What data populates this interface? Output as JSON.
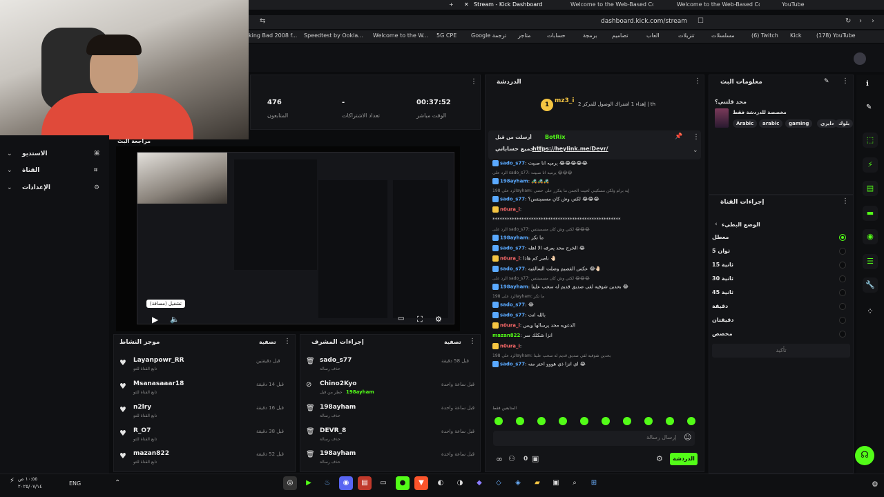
{
  "browser": {
    "tabs": [
      {
        "label": "Stream - Kick Dashboard",
        "active": true
      },
      {
        "label": "Welcome to the Web-Based Config"
      },
      {
        "label": "Welcome to the Web-Based Config"
      },
      {
        "label": "YouTube"
      }
    ],
    "url": "dashboard.kick.com/stream",
    "bookmarks": [
      "king Bad 2008 f...",
      "Speedtest by Ookla...",
      "Welcome to the W...",
      "5G CPE",
      "Google ترجمة",
      "متاجر",
      "حسابات",
      "برمجة",
      "تصاميم",
      "العاب",
      "تنزيلات",
      "مسلسلات",
      "(6) Twitch",
      "Kick",
      "(178) YouTube"
    ]
  },
  "stats": [
    {
      "value": "476",
      "label": "المتابعون"
    },
    {
      "value": "-",
      "label": "تعداد الاشتراكات"
    },
    {
      "value": "00:37:52",
      "label": "الوقت مباشر"
    }
  ],
  "sidebar": {
    "preview_title": "مراجعة البث",
    "items": [
      {
        "label": "الاستديو"
      },
      {
        "label": "القناة"
      },
      {
        "label": "الإعدادات"
      }
    ]
  },
  "player": {
    "tooltip": "تشغيل (مسافة)"
  },
  "activity_feed": {
    "title": "موجز النشاط",
    "filter": "تصفية",
    "items": [
      {
        "name": "Layanpowr_RR",
        "sub": "تابع القناة للتو",
        "time": "قبل دقيقتين"
      },
      {
        "name": "Msanasaaar18",
        "sub": "تابع القناة للتو",
        "time": "قبل 14 دقيقة"
      },
      {
        "name": "n2lry",
        "sub": "تابع القناة للتو",
        "time": "قبل 16 دقيقة"
      },
      {
        "name": "R_O7",
        "sub": "تابع القناة للتو",
        "time": "قبل 38 دقيقة"
      },
      {
        "name": "mazan822",
        "sub": "تابع القناة للتو",
        "time": "قبل 52 دقيقة"
      }
    ]
  },
  "mod_actions": {
    "title": "إجراءات المشرف",
    "filter": "تصفية",
    "items": [
      {
        "name": "sado_s77",
        "sub": "حذف رسالة",
        "time": "قبل 58 دقيقة"
      },
      {
        "name": "Chino2Kyo",
        "sub": "حظر من قبل",
        "extra": "198ayham",
        "time": "قبل ساعة واحدة"
      },
      {
        "name": "198ayham",
        "sub": "حذف رسالة",
        "time": "قبل ساعة واحدة"
      },
      {
        "name": "DEVR_8",
        "sub": "حذف رسالة",
        "time": "قبل ساعة واحدة"
      },
      {
        "name": "198ayham",
        "sub": "حذف رسالة",
        "time": "قبل ساعة واحدة"
      }
    ]
  },
  "chat": {
    "title": "الدردشة",
    "top_gifter": {
      "name": "mz3_i",
      "rank": "1",
      "text": "إهداء 1 اشتراك الوصول للمركز 2 | th"
    },
    "pinned": {
      "by": "BotRix",
      "label": "أرسلت من قبل",
      "text": "جميع حساباتي 🖤",
      "link": "https://heylink.me/Devr/"
    },
    "messages": [
      {
        "user": "sado_s77",
        "color": "blue",
        "text": "يرميه انا صبيت 😂😂😂😂😂"
      },
      {
        "reply": "الرد على sado_s77: يرميه انا صبيت 😂😂😂"
      },
      {
        "user": "198ayham",
        "color": "blue",
        "text": "🚜🚜🚜"
      },
      {
        "reply": "الرد على 198ayham: إيه برام ولكن مسكيني لحيت الجمن ما يتكرر على حضي"
      },
      {
        "user": "sado_s77",
        "color": "blue",
        "text": "لكني وش كان مسمينتس؟ 😂😂😂"
      },
      {
        "user": "n0ura_i",
        "color": "red",
        "text": ""
      },
      {
        "user": "",
        "color": "plain",
        "text": "*****************************************************"
      },
      {
        "reply": "الرد على sado_s77: لكني وش كان مسمينتس 😂😂😂"
      },
      {
        "user": "198ayham",
        "color": "blue",
        "text": "ما تكر"
      },
      {
        "user": "sado_s77",
        "color": "blue",
        "text": "الخرج محد يعرفه الا اهله 😂"
      },
      {
        "user": "n0ura_i",
        "color": "red",
        "text": "ناصر كم هاذا 🤚🏻"
      },
      {
        "user": "sado_s77",
        "color": "blue",
        "text": "عكس الفصيم وصلت السالفيه 😂🤚🏻"
      },
      {
        "reply": "الرد على sado_s77: لكني وش كان مسمينتس 😂😂😂"
      },
      {
        "user": "198ayham",
        "color": "blue",
        "text": "بحدين شوفيه لفي صديق قديم له سحب علينا 😂"
      },
      {
        "reply": "الرد على 198ayham: ما تكر"
      },
      {
        "user": "sado_s77",
        "color": "blue",
        "text": "😂"
      },
      {
        "user": "sado_s77",
        "color": "blue",
        "text": "بالله انت"
      },
      {
        "user": "n0ura_i",
        "color": "red",
        "text": "الدعويه محد يرسالها ويس"
      },
      {
        "user": "mazan822",
        "color": "green",
        "text": "انزا شكلك سر"
      },
      {
        "user": "n0ura_i",
        "color": "red",
        "text": ""
      },
      {
        "reply": "الرد على 198ayham: بحدين شوفيه لفي صديق قديم له سحب علينا"
      },
      {
        "user": "sado_s77",
        "color": "blue",
        "text": "اي انزا ذي هووو احتر منه 😂"
      }
    ],
    "footer_note": "المتابعين فقط",
    "input_placeholder": "إرسال رسالة",
    "send_label": "الدردشة",
    "viewer_count": "0"
  },
  "stream_info": {
    "title": "معلومات البث",
    "stream_title": "محد قلتني؟",
    "category": "مخصصة للدردشة فقط",
    "tags": [
      "Arabic",
      "arabic",
      "gaming",
      "دايري",
      "بلوك"
    ]
  },
  "channel_actions": {
    "title": "إجراءات القناة",
    "section": "الوضع البطيء",
    "options": [
      {
        "label": "معطل",
        "selected": true
      },
      {
        "label": "ثوان 5"
      },
      {
        "label": "ثانية 15"
      },
      {
        "label": "ثانية 30"
      },
      {
        "label": "ثانية 45"
      },
      {
        "label": "دقيقة"
      },
      {
        "label": "دقيقتان"
      },
      {
        "label": "مخصص"
      }
    ],
    "confirm": "تأكيد"
  },
  "taskbar": {
    "time": "١٠:٥٥ ص",
    "date": "٢٠٢٥/٠٧/١٤",
    "lang": "ENG"
  },
  "colors": {
    "accent": "#53fc18",
    "bg": "#0b0c0e",
    "panel": "#131417"
  }
}
